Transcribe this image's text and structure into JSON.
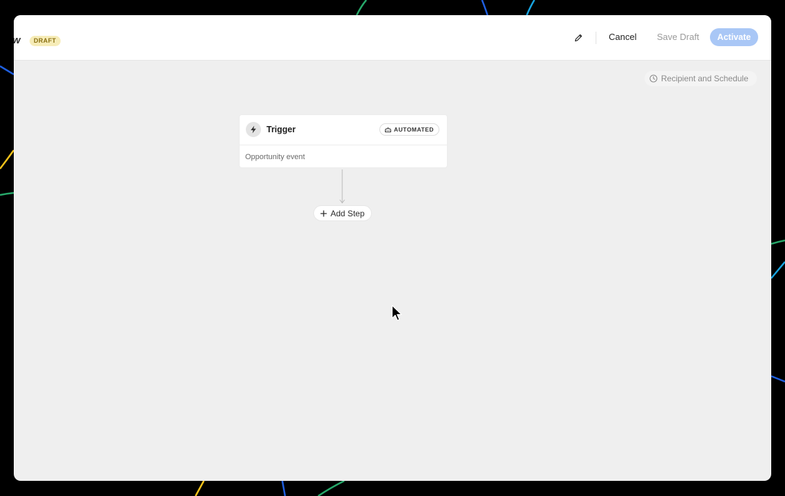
{
  "header": {
    "title_fragment": "w",
    "status_badge": "DRAFT",
    "cancel_label": "Cancel",
    "save_draft_label": "Save Draft",
    "activate_label": "Activate"
  },
  "canvas": {
    "schedule_button_label": "Recipient and Schedule"
  },
  "trigger_card": {
    "title": "Trigger",
    "mode_badge": "AUTOMATED",
    "event_label": "Opportunity event"
  },
  "add_step_label": "Add Step",
  "icons": {
    "edit": "pencil-icon",
    "schedule": "clock-icon",
    "trigger": "lightning-icon",
    "automated": "robot-icon",
    "add": "plus-icon"
  },
  "colors": {
    "draft_badge_bg": "#f6ecb8",
    "draft_badge_text": "#8a7012",
    "activate_bg": "#a9c7f6",
    "canvas_bg": "#efefef",
    "line_blue": "#1f5fe0",
    "line_cyan": "#18a4e0",
    "line_green": "#27a86a",
    "line_yellow": "#f2c21a"
  }
}
